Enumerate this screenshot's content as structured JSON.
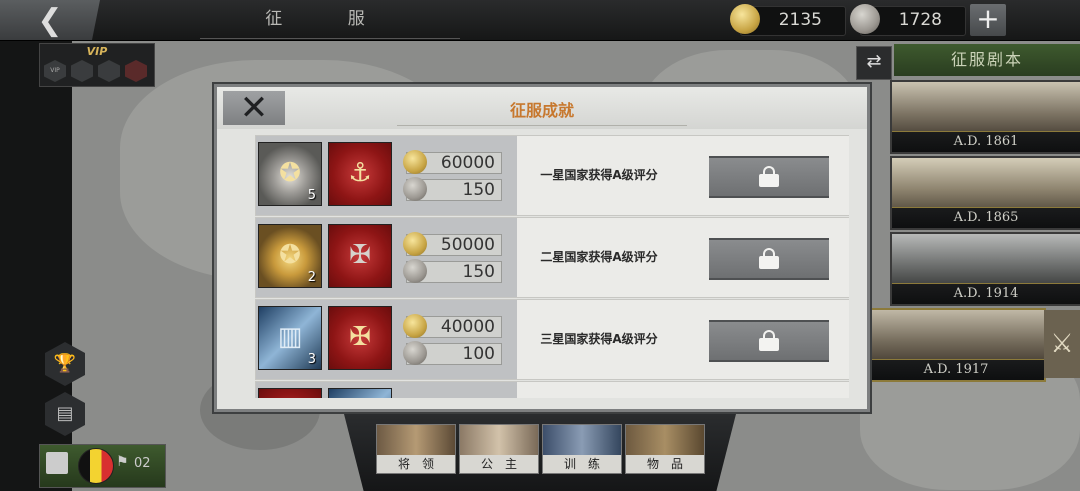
{
  "topbar": {
    "back_icon": "chevron-left-icon",
    "title": "征 服",
    "gold": "2135",
    "silver": "1728",
    "add_label": "+"
  },
  "vip": {
    "label": "VIP",
    "badges": [
      "VIP",
      "",
      "",
      ""
    ]
  },
  "scenario": {
    "header": "征服剧本",
    "cards": [
      {
        "year": "A.D. 1861"
      },
      {
        "year": "A.D. 1865"
      },
      {
        "year": "A.D. 1914"
      },
      {
        "year": "A.D. 1917"
      }
    ]
  },
  "save_bar": {
    "count": "02"
  },
  "bottom_tabs": [
    "将领",
    "公主",
    "训练",
    "物品"
  ],
  "modal": {
    "title": "征服成就",
    "close_label": "✕",
    "rows": [
      {
        "count": "5",
        "gold": "60000",
        "silver": "150",
        "condition": "一星国家获得A级评分",
        "locked": true
      },
      {
        "count": "2",
        "gold": "50000",
        "silver": "150",
        "condition": "二星国家获得A级评分",
        "locked": true
      },
      {
        "count": "3",
        "gold": "40000",
        "silver": "100",
        "condition": "三星国家获得A级评分",
        "locked": true
      }
    ]
  },
  "colors": {
    "accent_title": "#c7782e",
    "scenario_green": "#3e5a2e",
    "gold_coin": "#c8a545"
  }
}
